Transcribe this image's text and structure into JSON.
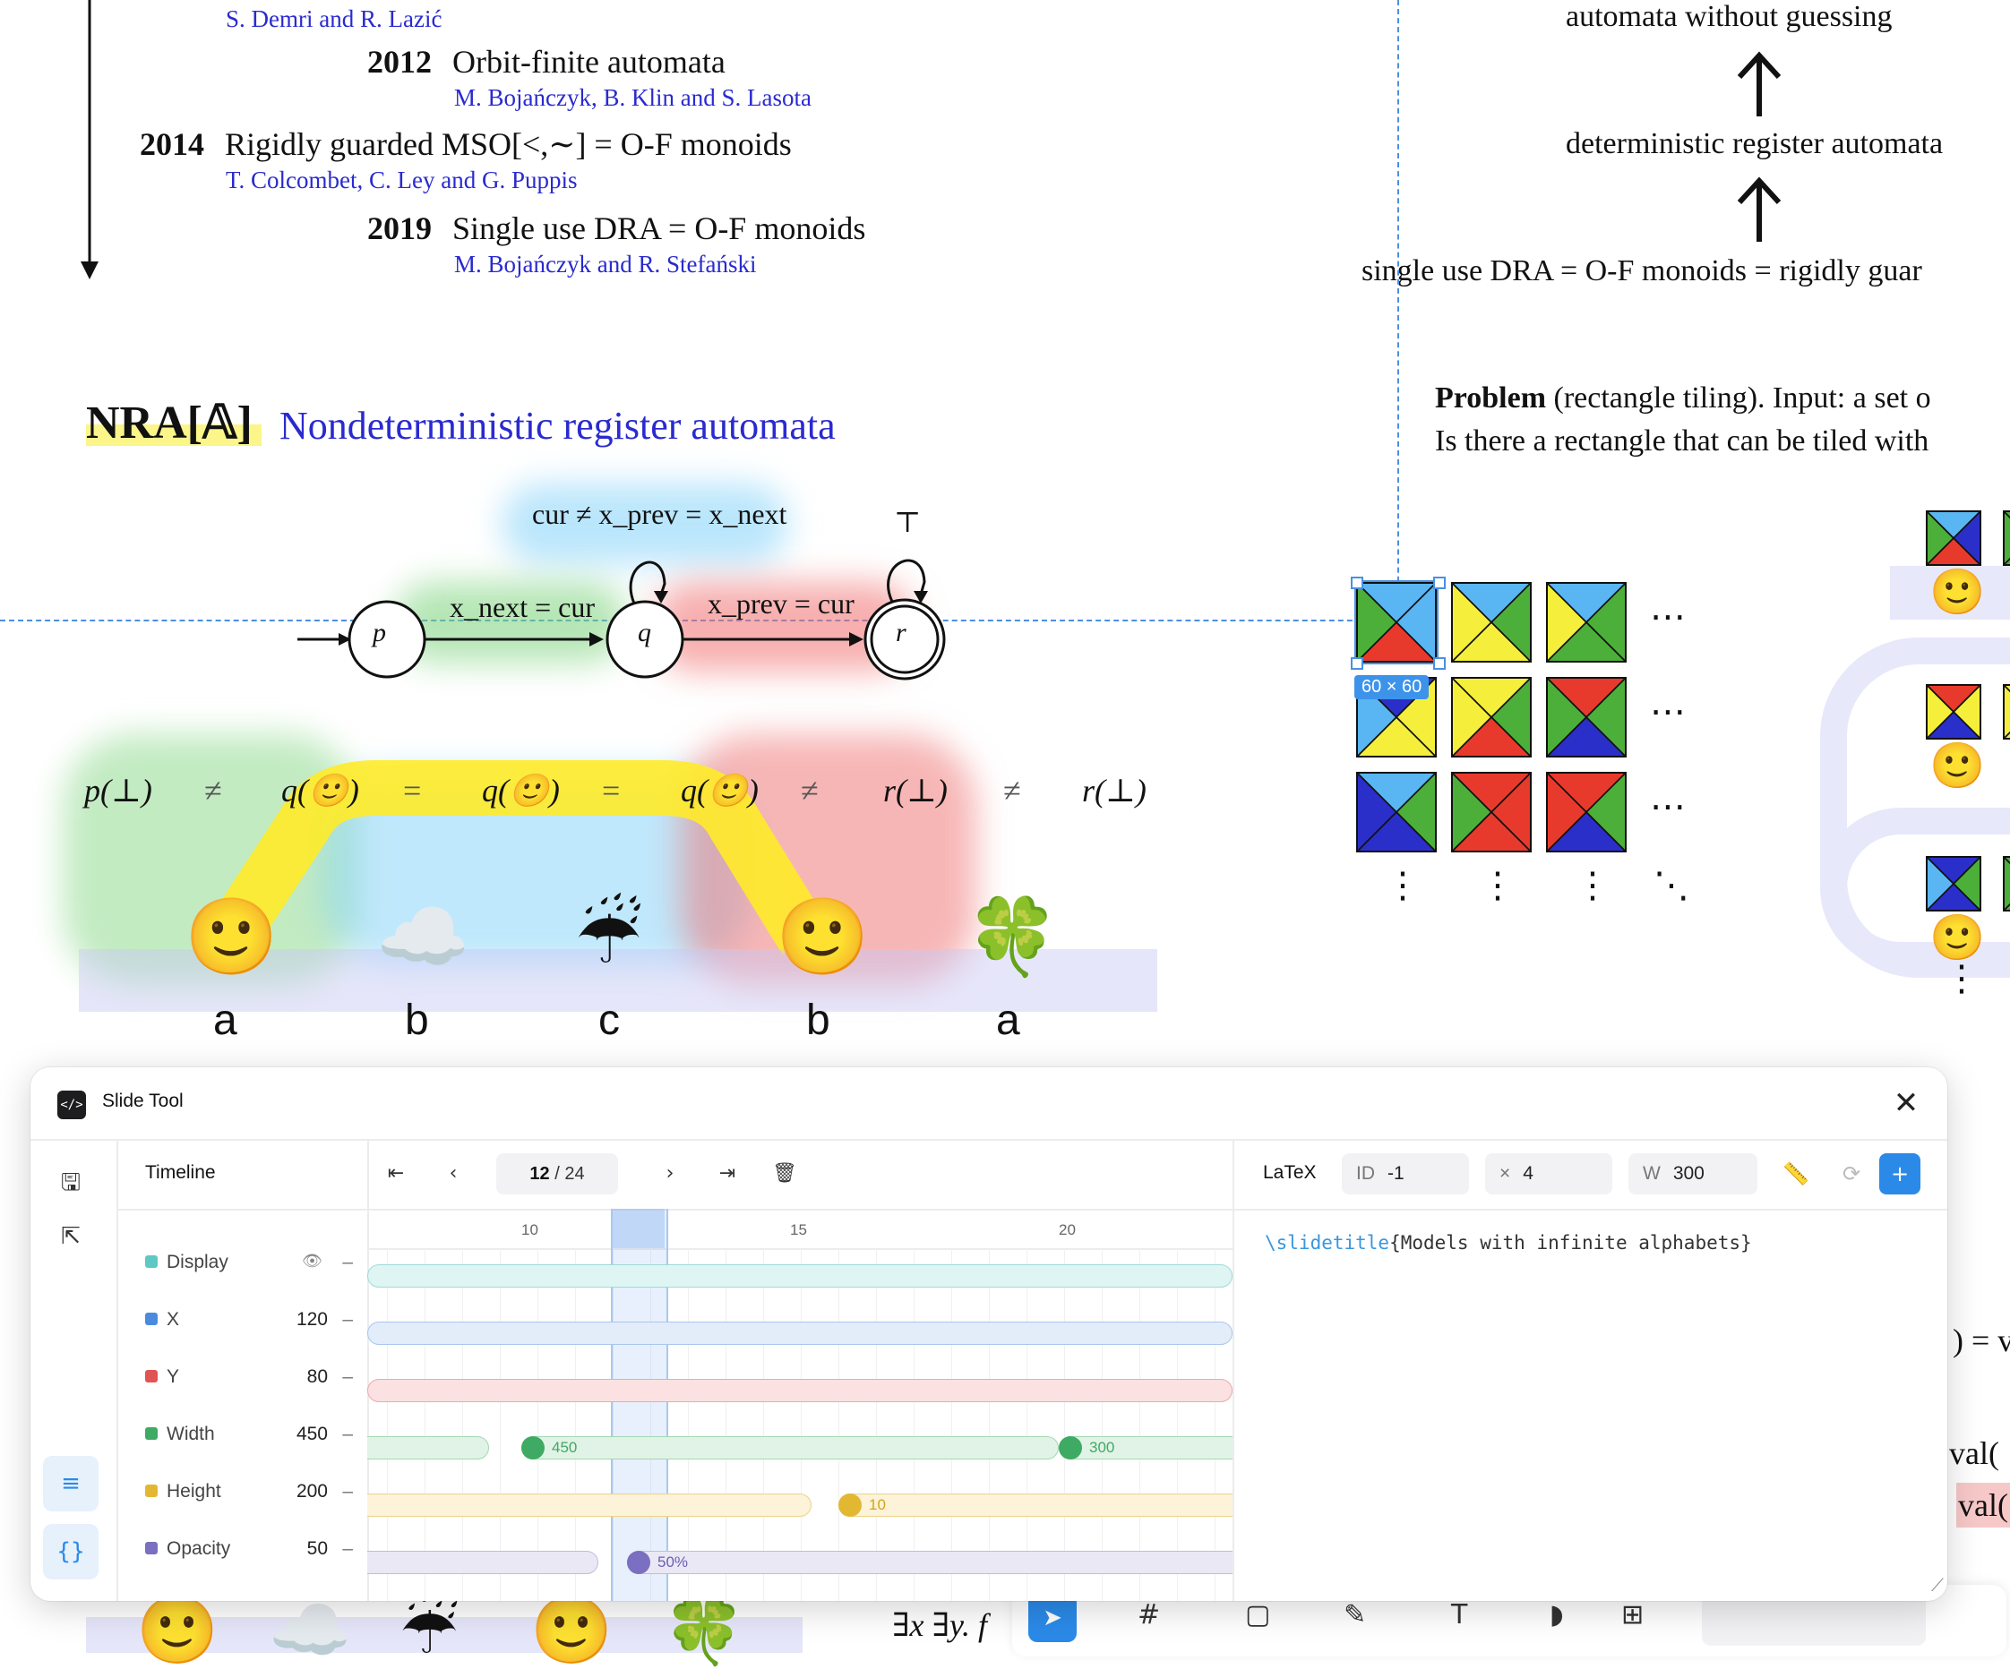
{
  "timeline_top": {
    "authors_1": "S. Demri and R. Lazić",
    "y2012": "2012",
    "t2012": "Orbit-finite automata",
    "a2012": "M. Bojańczyk, B. Klin and S. Lasota",
    "y2014": "2014",
    "t2014": "Rigidly guarded MSO[<,∼] = O-F monoids",
    "a2014": "T. Colcombet, C. Ley and G. Puppis",
    "y2019": "2019",
    "t2019": "Single use DRA = O-F monoids",
    "a2019": "M. Bojańczyk and R. Stefański"
  },
  "hierarchy": {
    "top": "automata without guessing",
    "middle": "deterministic register automata",
    "bottom": "single use DRA = O-F monoids = rigidly guar"
  },
  "nra": {
    "symbol": "NRA[𝔸]",
    "title": "Nondeterministic register automata"
  },
  "automaton": {
    "loop_q_label": "cur ≠ x_prev = x_next",
    "edge_pq": "x_next = cur",
    "edge_qr": "x_prev = cur",
    "loop_r_label": "⊤",
    "states": [
      "p",
      "q",
      "r"
    ]
  },
  "run": {
    "terms": [
      "p(⊥)",
      "≠",
      "q(🙂)",
      "=",
      "q(🙂)",
      "=",
      "q(🙂)",
      "≠",
      "r(⊥)",
      "≠",
      "r(⊥)"
    ],
    "emojis": [
      "🙂",
      "☁️",
      "☔",
      "🙂",
      "🍀"
    ],
    "letters": [
      "a",
      "b",
      "c",
      "b",
      "a"
    ]
  },
  "problem": {
    "label": "Problem",
    "paren": "(rectangle tiling).",
    "line1_rest": "Input: a set o",
    "line2": "Is there a rectangle that can be tiled with"
  },
  "selection": {
    "size_badge": "60 × 60"
  },
  "right_edge": {
    "r1": ") = v",
    "r2": "val(",
    "r3": "val("
  },
  "bottom_peek": {
    "formula": "∃x ∃y. f"
  },
  "panel": {
    "title": "Slide Tool",
    "close_glyph": "✕",
    "timeline_label": "Timeline",
    "page_current": "12",
    "page_total": "/ 24",
    "ruler_ticks": [
      "10",
      "15",
      "20"
    ],
    "tracks": [
      {
        "name": "Display",
        "value": "",
        "color": "#5ec8c3"
      },
      {
        "name": "X",
        "value": "120",
        "color": "#4a8be0"
      },
      {
        "name": "Y",
        "value": "80",
        "color": "#e05454"
      },
      {
        "name": "Width",
        "value": "450",
        "color": "#3faa63"
      },
      {
        "name": "Height",
        "value": "200",
        "color": "#e2b833"
      },
      {
        "name": "Opacity",
        "value": "50",
        "color": "#7a6fc0"
      }
    ],
    "keyframes": {
      "width_a": "450",
      "width_b": "300",
      "height_a": "10",
      "opacity_a": "50%"
    },
    "latex": {
      "label": "LaTeX",
      "id_key": "ID",
      "id_val": "-1",
      "x_key": "×",
      "x_val": "4",
      "w_key": "W",
      "w_val": "300",
      "code_cmd": "\\slidetitle",
      "code_arg": "{Models with infinite alphabets}"
    }
  }
}
